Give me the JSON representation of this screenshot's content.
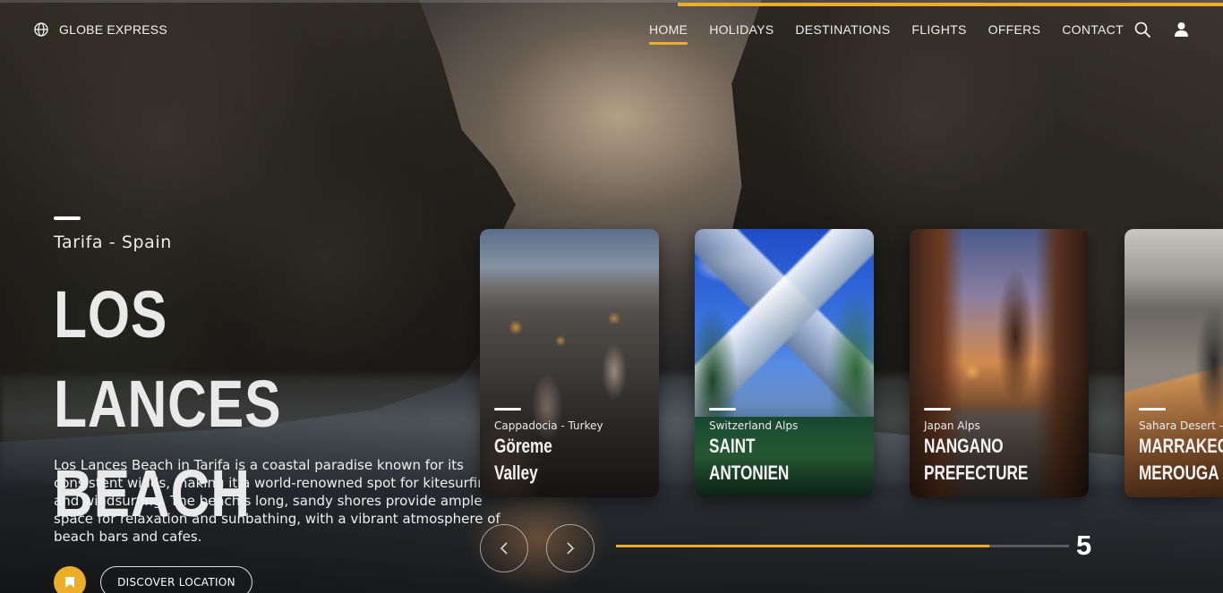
{
  "brand": {
    "name": "GLOBE EXPRESS",
    "icon": "globe-icon"
  },
  "nav": {
    "items": [
      {
        "label": "HOME",
        "active": true
      },
      {
        "label": "HOLIDAYS",
        "active": false
      },
      {
        "label": "DESTINATIONS",
        "active": false
      },
      {
        "label": "FLIGHTS",
        "active": false
      },
      {
        "label": "OFFERS",
        "active": false
      },
      {
        "label": "CONTACT",
        "active": false
      }
    ],
    "icons": [
      "search-icon",
      "user-icon"
    ]
  },
  "hero": {
    "location": "Tarifa - Spain",
    "title_line1": "LOS LANCES",
    "title_line2": "BEACH",
    "description": "Los Lances Beach in Tarifa is a coastal paradise known for its consistent winds, making it a world-renowned spot for kitesurfing and windsurfing. The beach's long, sandy shores provide ample space for relaxation and sunbathing, with a vibrant atmosphere of beach bars and cafes.",
    "bookmark_icon": "bookmark-icon",
    "cta_label": "DISCOVER LOCATION"
  },
  "cards": [
    {
      "subtitle": "Cappadocia - Turkey",
      "title": "Göreme\nValley"
    },
    {
      "subtitle": "Switzerland Alps",
      "title": "SAINT\nANTONIEN"
    },
    {
      "subtitle": "Japan Alps",
      "title": "NANGANO\nPREFECTURE"
    },
    {
      "subtitle": "Sahara Desert - Morocco",
      "title": "MARRAKECH\nMEROUGA"
    }
  ],
  "slider": {
    "current": "5",
    "progress_fraction": 0.825,
    "prev_icon": "chevron-left-icon",
    "next_icon": "chevron-right-icon"
  },
  "colors": {
    "accent": "#ecad29",
    "text": "#ffffff"
  }
}
